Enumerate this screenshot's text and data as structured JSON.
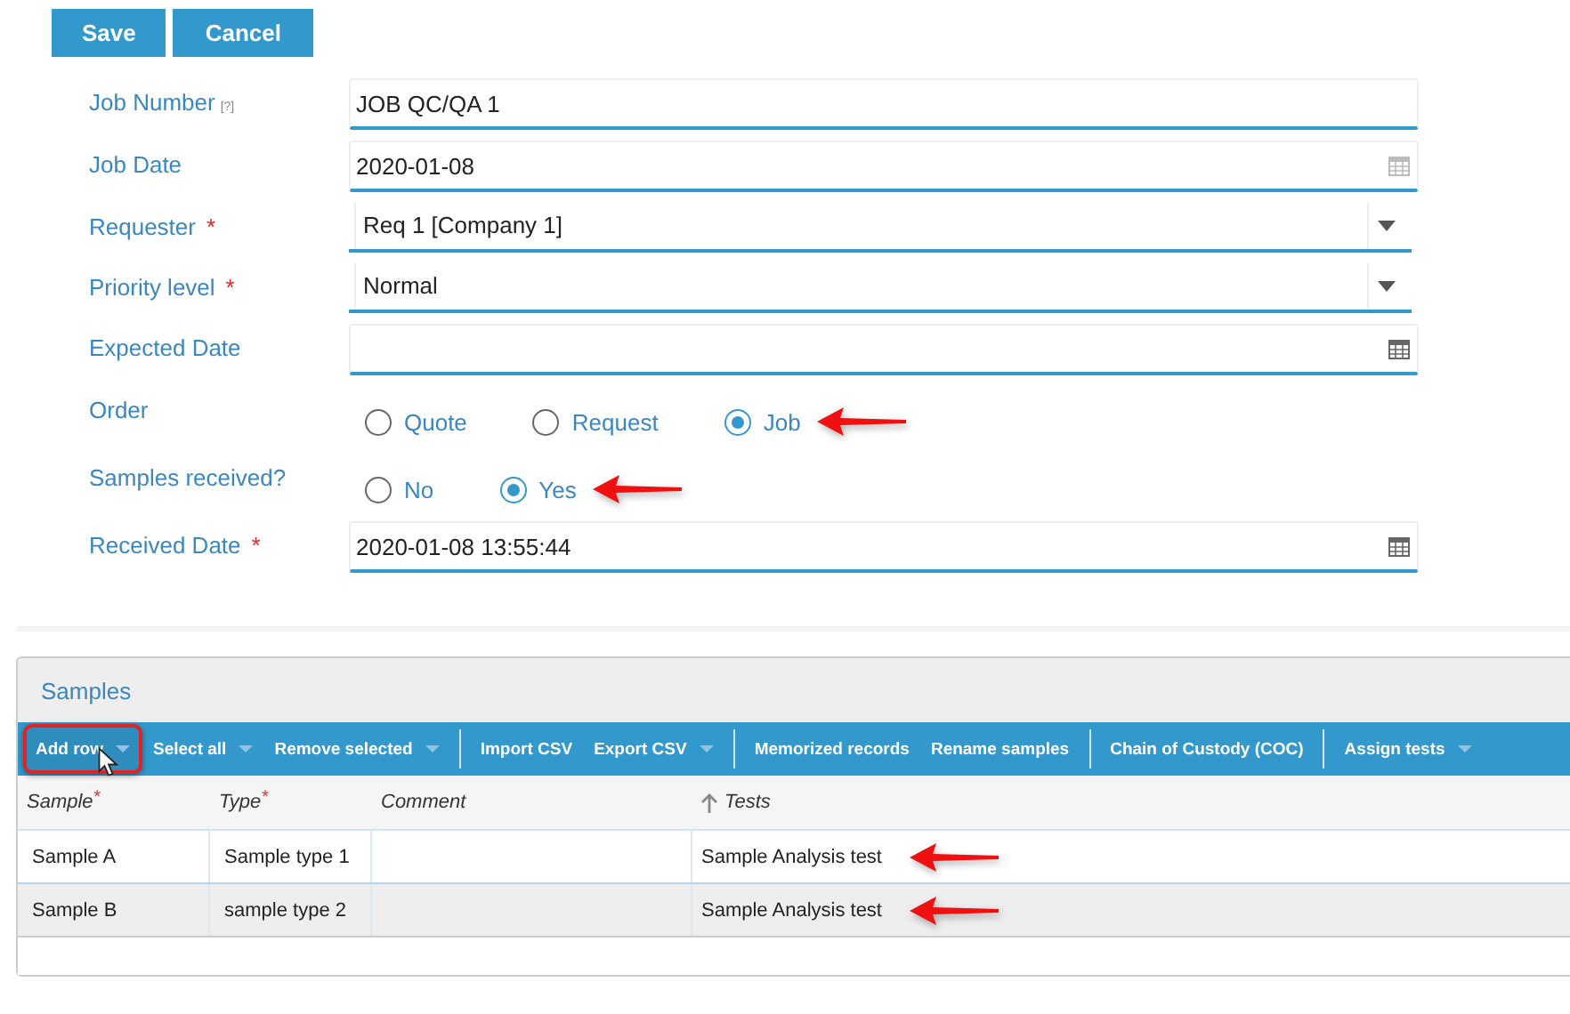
{
  "actions": [
    {
      "label": "Save"
    },
    {
      "label": "Cancel"
    }
  ],
  "fields": [
    {
      "kind": "text",
      "label": "Job Number",
      "help": "[?]",
      "value": "JOB QC/QA 1"
    },
    {
      "kind": "date",
      "label": "Job Date",
      "value": "2020-01-08"
    },
    {
      "kind": "select",
      "label": "Requester",
      "mark": "*",
      "value": "Req 1 [Company 1]"
    },
    {
      "kind": "select",
      "label": "Priority level",
      "mark": "*",
      "value": "Normal"
    },
    {
      "kind": "date",
      "label": "Expected Date"
    },
    {
      "kind": "radio",
      "label": "Order",
      "callout": true,
      "options": [
        {
          "label": "Quote",
          "selected": false
        },
        {
          "label": "Request",
          "selected": false
        },
        {
          "label": "Job",
          "selected": true
        }
      ]
    },
    {
      "kind": "radio",
      "label": "Samples received?",
      "callout": true,
      "options": [
        {
          "label": "No",
          "selected": false
        },
        {
          "label": "Yes",
          "selected": true
        }
      ]
    },
    {
      "kind": "date",
      "label": "Received Date",
      "mark": "*",
      "value": "2020-01-08 13:55:44"
    }
  ],
  "samples": {
    "title": "Samples",
    "toolbar": [
      {
        "label": "Add row",
        "caret": true,
        "highlighted": true,
        "separator_after": false
      },
      {
        "label": "Select all",
        "caret": true,
        "highlighted": false,
        "separator_after": false
      },
      {
        "label": "Remove selected",
        "caret": true,
        "highlighted": false,
        "separator_after": true
      },
      {
        "label": "Import CSV",
        "caret": false,
        "highlighted": false,
        "separator_after": false
      },
      {
        "label": "Export CSV",
        "caret": true,
        "highlighted": false,
        "separator_after": true
      },
      {
        "label": "Memorized records",
        "caret": false,
        "highlighted": false,
        "separator_after": false
      },
      {
        "label": "Rename samples",
        "caret": false,
        "highlighted": false,
        "separator_after": true
      },
      {
        "label": "Chain of Custody (COC)",
        "caret": false,
        "highlighted": false,
        "separator_after": true
      },
      {
        "label": "Assign tests",
        "caret": true,
        "highlighted": false,
        "separator_after": false
      }
    ],
    "columns": [
      {
        "label": "Sample",
        "mark": "*",
        "sorted": false
      },
      {
        "label": "Type",
        "mark": "*",
        "sorted": false
      },
      {
        "label": "Comment",
        "sorted": false
      },
      {
        "label": "Tests",
        "sorted": true
      }
    ],
    "rows": [
      {
        "cells": [
          "Sample A",
          "Sample type 1",
          "",
          "Sample Analysis test"
        ],
        "callout": true
      },
      {
        "cells": [
          "Sample B",
          "sample type 2",
          "",
          "Sample Analysis test"
        ],
        "callout": true
      }
    ]
  }
}
